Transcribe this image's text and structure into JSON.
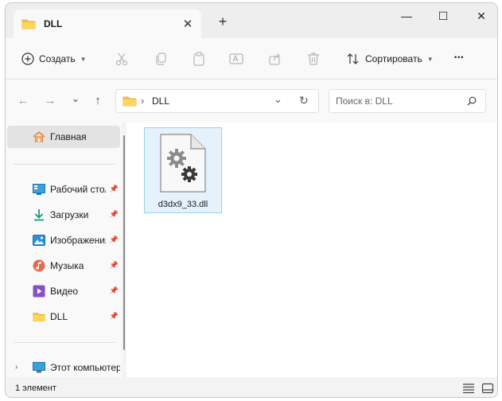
{
  "tab": {
    "title": "DLL",
    "close_glyph": "✕",
    "new_tab_glyph": "+"
  },
  "window_controls": {
    "minimize": "—",
    "maximize": "☐",
    "close": "✕"
  },
  "toolbar": {
    "new_label": "Создать",
    "sort_label": "Сортировать",
    "more_glyph": "•••",
    "icons": [
      "cut-icon",
      "copy-icon",
      "paste-icon",
      "rename-icon",
      "share-icon",
      "delete-icon"
    ]
  },
  "nav": {
    "back": "←",
    "forward": "→",
    "recent": "⌄",
    "up": "↑"
  },
  "address": {
    "separator": "›",
    "path": "DLL",
    "dropdown": "⌄",
    "refresh": "↻"
  },
  "search": {
    "placeholder": "Поиск в: DLL"
  },
  "sidebar": {
    "home": "Главная",
    "quick": [
      {
        "label": "Рабочий стол",
        "icon": "desktop-icon"
      },
      {
        "label": "Загрузки",
        "icon": "download-icon"
      },
      {
        "label": "Изображения",
        "icon": "pictures-icon"
      },
      {
        "label": "Музыка",
        "icon": "music-icon"
      },
      {
        "label": "Видео",
        "icon": "video-icon"
      },
      {
        "label": "DLL",
        "icon": "folder-icon"
      }
    ],
    "computer": "Этот компьютер"
  },
  "files": [
    {
      "name": "d3dx9_33.dll",
      "icon": "dll-settings-file-icon"
    }
  ],
  "status": {
    "count": "1 элемент"
  },
  "colors": {
    "accent": "#0067c0",
    "selection": "#e5f1fb",
    "selection_border": "#99d1f5",
    "folder": "#f5c342"
  }
}
